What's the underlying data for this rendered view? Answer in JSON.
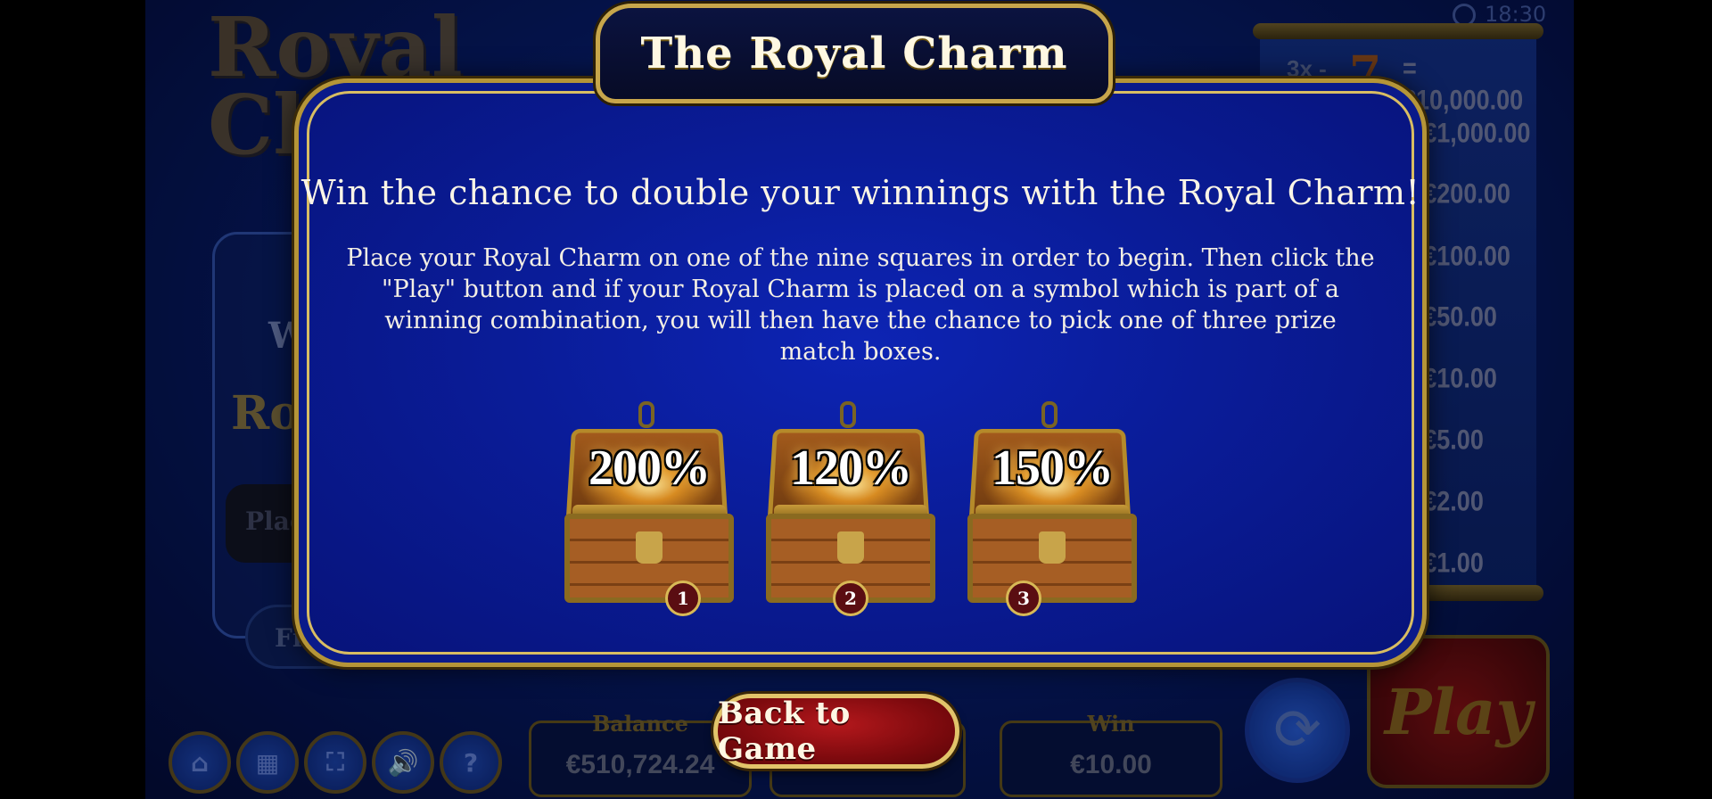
{
  "background": {
    "logo_text": "Royal Charm",
    "side_panel_text_1": "W",
    "side_panel_text_2": "Roy",
    "place_button_label": "Place",
    "find_button_label": "Find out",
    "clock_time": "18:30",
    "paytable": {
      "multiplier_label": "3x -",
      "rows": [
        "= €10,000.00",
        "= €1,000.00",
        "= €200.00",
        "= €100.00",
        "= €50.00",
        "= €10.00",
        "= €5.00",
        "= €2.00",
        "= €1.00"
      ]
    },
    "balance_label": "Balance",
    "balance_value": "€510,724.24",
    "win_label": "Win",
    "win_value": "€10.00",
    "play_button_label": "Play"
  },
  "modal": {
    "title": "The Royal Charm",
    "heading": "Win the chance to double your winnings with the Royal Charm!",
    "body": "Place your Royal Charm on one of the nine squares in order to begin. Then click the \"Play\" button and if your Royal Charm is placed on a symbol which is part of a winning combination, you will then have the chance to pick one of three prize match boxes.",
    "chests": [
      {
        "percent": "200%",
        "number": "1"
      },
      {
        "percent": "120%",
        "number": "2"
      },
      {
        "percent": "150%",
        "number": "3"
      }
    ],
    "back_button_label": "Back to Game"
  },
  "bottom_icons": [
    "home-icon",
    "paytable-icon",
    "fullscreen-icon",
    "sound-icon",
    "help-icon"
  ],
  "colors": {
    "modal_bg": "#0a1c98",
    "gold_border": "#c7a64b",
    "button_red": "#9e1418"
  }
}
